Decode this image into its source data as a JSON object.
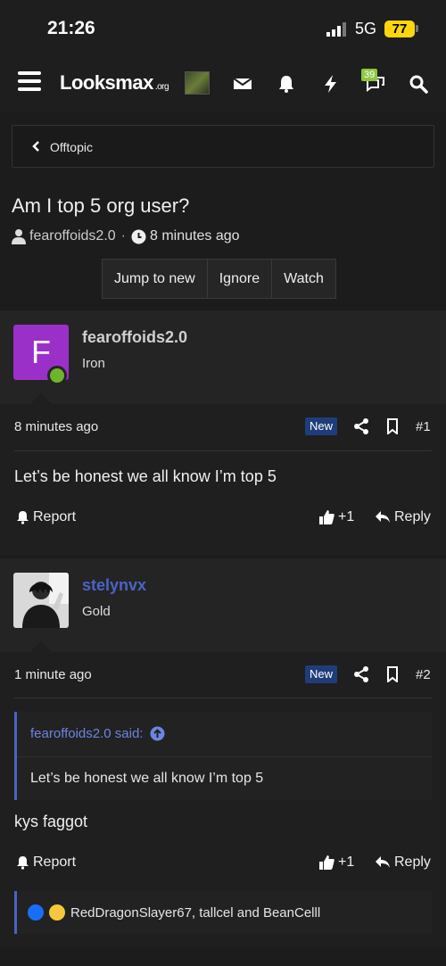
{
  "status_bar": {
    "time": "21:26",
    "network": "5G",
    "battery": "77"
  },
  "nav": {
    "logo_text": "Looksmax",
    "logo_suffix": ".org",
    "alerts_badge": "39"
  },
  "breadcrumb": {
    "label": "Offtopic"
  },
  "thread": {
    "title": "Am I top 5 org user?",
    "author": "fearoffoids2.0",
    "age": "8 minutes ago",
    "buttons": {
      "jump": "Jump to new",
      "ignore": "Ignore",
      "watch": "Watch"
    }
  },
  "posts": [
    {
      "username": "fearoffoids2.0",
      "user_title": "Iron",
      "avatar_letter": "F",
      "avatar_color": "#9b30c8",
      "username_color": "#d0d0d0",
      "time": "8 minutes ago",
      "new_label": "New",
      "number": "#1",
      "body": "Let’s be honest we all know I’m top 5",
      "report_label": "Report",
      "plus_label": "+1",
      "reply_label": "Reply"
    },
    {
      "username": "stelynvx",
      "user_title": "Gold",
      "username_color": "#4a63c7",
      "time": "1 minute ago",
      "new_label": "New",
      "number": "#2",
      "quote_author": "fearoffoids2.0 said:",
      "quote_body": "Let’s be honest we all know I’m top 5",
      "body": "kys faggot",
      "report_label": "Report",
      "plus_label": "+1",
      "reply_label": "Reply",
      "reactions_text": "RedDragonSlayer67, tallcel and BeanCelll"
    }
  ],
  "colors": {
    "accent": "#4a63c7",
    "new_badge": "#1f3d7a",
    "online": "#6fb52c"
  }
}
